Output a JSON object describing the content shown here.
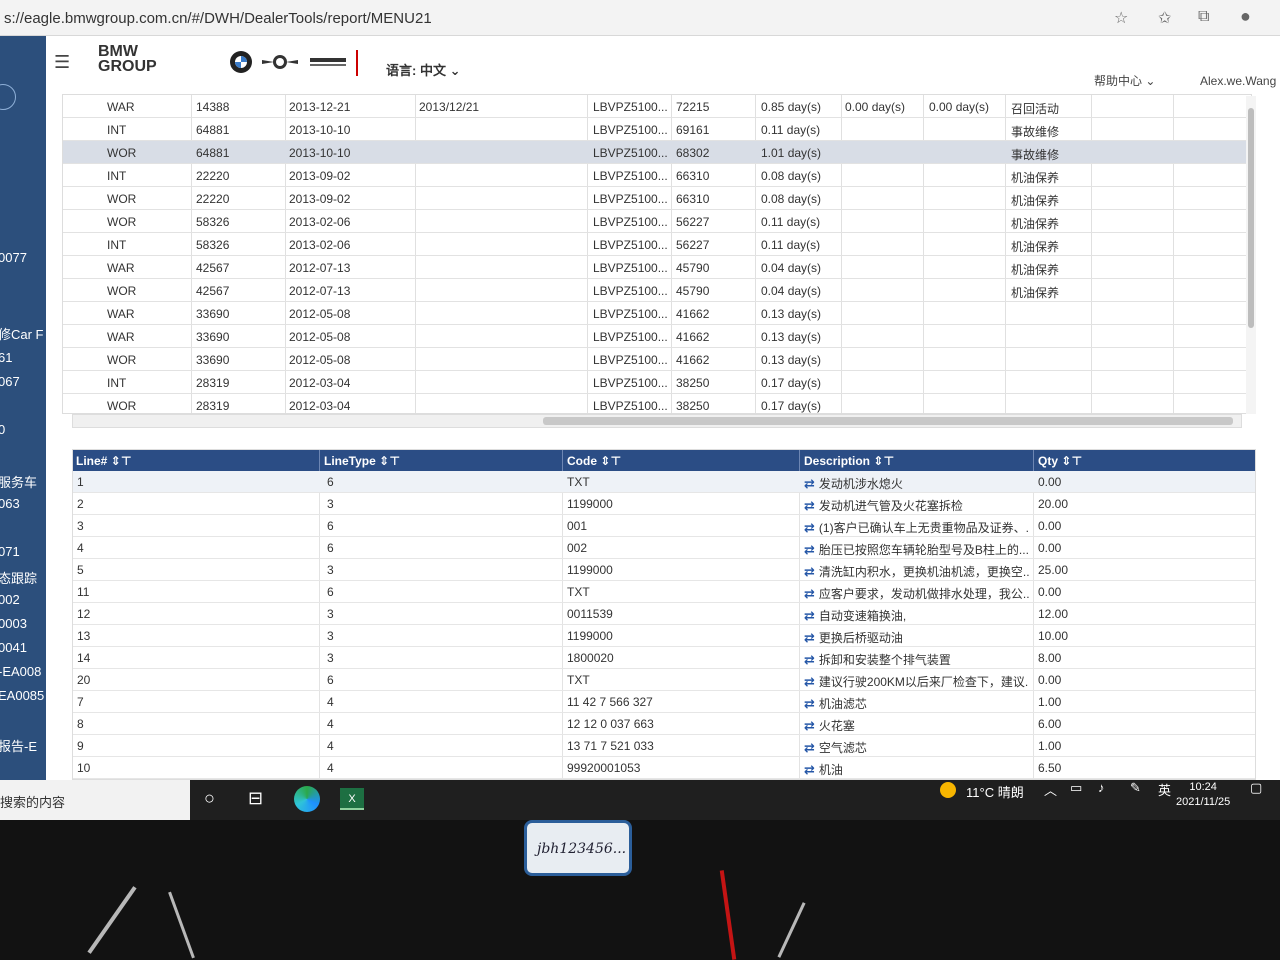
{
  "browser": {
    "url": "s://eagle.bmwgroup.com.cn/#/DWH/DealerTools/report/MENU21"
  },
  "sidebar": {
    "items": [
      "0077",
      "修Car F",
      "61",
      "067",
      "0",
      "服务车",
      "063",
      "071",
      "态跟踪",
      "002",
      "0003",
      "0041",
      "-EA008",
      "EA0085",
      "报告-E"
    ]
  },
  "header": {
    "logo": "BMW\nGROUP",
    "language": "语言: 中文",
    "help": "帮助中心",
    "user": "Alex.we.Wang"
  },
  "top_table": {
    "rows": [
      [
        "WAR",
        "14388",
        "2013-12-21",
        "2013/12/21",
        "LBVPZ5100...",
        "72215",
        "0.85 day(s)",
        "0.00 day(s)",
        "0.00 day(s)",
        "召回活动"
      ],
      [
        "INT",
        "64881",
        "2013-10-10",
        "",
        "LBVPZ5100...",
        "69161",
        "0.11 day(s)",
        "",
        "",
        "事故维修"
      ],
      [
        "WOR",
        "64881",
        "2013-10-10",
        "",
        "LBVPZ5100...",
        "68302",
        "1.01 day(s)",
        "",
        "",
        "事故维修"
      ],
      [
        "INT",
        "22220",
        "2013-09-02",
        "",
        "LBVPZ5100...",
        "66310",
        "0.08 day(s)",
        "",
        "",
        "机油保养"
      ],
      [
        "WOR",
        "22220",
        "2013-09-02",
        "",
        "LBVPZ5100...",
        "66310",
        "0.08 day(s)",
        "",
        "",
        "机油保养"
      ],
      [
        "WOR",
        "58326",
        "2013-02-06",
        "",
        "LBVPZ5100...",
        "56227",
        "0.11 day(s)",
        "",
        "",
        "机油保养"
      ],
      [
        "INT",
        "58326",
        "2013-02-06",
        "",
        "LBVPZ5100...",
        "56227",
        "0.11 day(s)",
        "",
        "",
        "机油保养"
      ],
      [
        "WAR",
        "42567",
        "2012-07-13",
        "",
        "LBVPZ5100...",
        "45790",
        "0.04 day(s)",
        "",
        "",
        "机油保养"
      ],
      [
        "WOR",
        "42567",
        "2012-07-13",
        "",
        "LBVPZ5100...",
        "45790",
        "0.04 day(s)",
        "",
        "",
        "机油保养"
      ],
      [
        "WAR",
        "33690",
        "2012-05-08",
        "",
        "LBVPZ5100...",
        "41662",
        "0.13 day(s)",
        "",
        "",
        ""
      ],
      [
        "WAR",
        "33690",
        "2012-05-08",
        "",
        "LBVPZ5100...",
        "41662",
        "0.13 day(s)",
        "",
        "",
        ""
      ],
      [
        "WOR",
        "33690",
        "2012-05-08",
        "",
        "LBVPZ5100...",
        "41662",
        "0.13 day(s)",
        "",
        "",
        ""
      ],
      [
        "INT",
        "28319",
        "2012-03-04",
        "",
        "LBVPZ5100...",
        "38250",
        "0.17 day(s)",
        "",
        "",
        ""
      ],
      [
        "WOR",
        "28319",
        "2012-03-04",
        "",
        "LBVPZ5100...",
        "38250",
        "0.17 day(s)",
        "",
        "",
        ""
      ]
    ]
  },
  "bottom_table": {
    "columns": [
      "Line#",
      "LineType",
      "Code",
      "Description",
      "Qty"
    ],
    "rows": [
      [
        "1",
        "6",
        "TXT",
        "发动机涉水熄火",
        "0.00"
      ],
      [
        "2",
        "3",
        "1199000",
        "发动机进气管及火花塞拆检",
        "20.00"
      ],
      [
        "3",
        "6",
        "001",
        "(1)客户已确认车上无贵重物品及证券、...",
        "0.00"
      ],
      [
        "4",
        "6",
        "002",
        "胎压已按照您车辆轮胎型号及B柱上的...",
        "0.00"
      ],
      [
        "5",
        "3",
        "1199000",
        "清洗缸内积水，更换机油机滤，更换空...",
        "25.00"
      ],
      [
        "11",
        "6",
        "TXT",
        "应客户要求，发动机做排水处理，我公...",
        "0.00"
      ],
      [
        "12",
        "3",
        "0011539",
        "自动变速箱换油,",
        "12.00"
      ],
      [
        "13",
        "3",
        "1199000",
        "更换后桥驱动油",
        "10.00"
      ],
      [
        "14",
        "3",
        "1800020",
        "拆卸和安装整个排气装置",
        "8.00"
      ],
      [
        "20",
        "6",
        "TXT",
        "建议行驶200KM以后来厂检查下，建议...",
        "0.00"
      ],
      [
        "7",
        "4",
        "11 42 7 566 327",
        "机油滤芯",
        "1.00"
      ],
      [
        "8",
        "4",
        "12 12 0 037 663",
        "火花塞",
        "6.00"
      ],
      [
        "9",
        "4",
        "13 71 7 521 033",
        "空气滤芯",
        "1.00"
      ],
      [
        "10",
        "4",
        "99920001053",
        "机油",
        "6.50"
      ]
    ]
  },
  "taskbar": {
    "search": "搜索的内容",
    "weather": "11°C  晴朗",
    "ime": "英",
    "time": "10:24",
    "date": "2021/11/25"
  },
  "sticker": {
    "text": "jbh123456..."
  },
  "icons": {
    "menu": "hamburger-icon",
    "bmw": "bmw-logo-icon",
    "mini": "mini-logo-icon",
    "rolls": "rolls-royce-logo-icon",
    "swap": "swap-arrows-icon",
    "sort": "sort-filter-icon"
  }
}
